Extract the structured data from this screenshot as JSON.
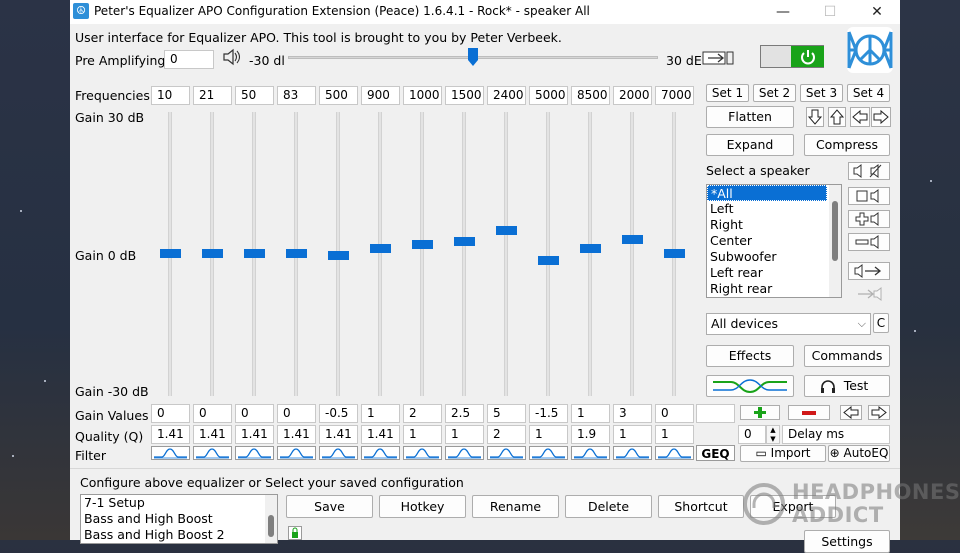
{
  "window": {
    "title": "Peter's Equalizer APO Configuration Extension (Peace) 1.6.4.1 - Rock* - speaker All",
    "minimize": "—",
    "maximize": "☐",
    "close": "✕"
  },
  "header": {
    "intro": "User interface for Equalizer APO. This tool is brought to you by Peter Verbeek.",
    "pre_amp_label": "Pre Amplifying",
    "pre_amp_value": "0",
    "pre_amp_min": "-30 dl",
    "pre_amp_max": "30 dE",
    "pre_amp_fraction": 0.5,
    "power_color": "#19a319"
  },
  "eq": {
    "frequencies_label": "Frequencies",
    "gain_top_label": "Gain 30 dB",
    "gain_mid_label": "Gain 0 dB",
    "gain_bottom_label": "Gain -30 dB",
    "gain_values_label": "Gain Values",
    "quality_label": "Quality (Q)",
    "filter_label": "Filter",
    "gain_range": [
      -30,
      30
    ],
    "bands": [
      {
        "freq": "10",
        "gain": "0",
        "q": "1.41"
      },
      {
        "freq": "21",
        "gain": "0",
        "q": "1.41"
      },
      {
        "freq": "50",
        "gain": "0",
        "q": "1.41"
      },
      {
        "freq": "83",
        "gain": "0",
        "q": "1.41"
      },
      {
        "freq": "500",
        "gain": "-0.5",
        "q": "1.41"
      },
      {
        "freq": "900",
        "gain": "1",
        "q": "1.41"
      },
      {
        "freq": "1000",
        "gain": "2",
        "q": "1"
      },
      {
        "freq": "1500",
        "gain": "2.5",
        "q": "1"
      },
      {
        "freq": "2400",
        "gain": "5",
        "q": "2"
      },
      {
        "freq": "5000",
        "gain": "-1.5",
        "q": "1"
      },
      {
        "freq": "8500",
        "gain": "1",
        "q": "1.9"
      },
      {
        "freq": "2000",
        "gain": "3",
        "q": "1"
      },
      {
        "freq": "7000",
        "gain": "0",
        "q": "1"
      }
    ],
    "geq_label": "GEQ",
    "delay_value": "0",
    "delay_label": "Delay ms",
    "import_label": "Import",
    "autoeq_label": "AutoEQ"
  },
  "right_panel": {
    "sets": [
      "Set 1",
      "Set 2",
      "Set 3",
      "Set 4"
    ],
    "flatten": "Flatten",
    "expand": "Expand",
    "compress": "Compress",
    "select_speaker": "Select a speaker",
    "speakers": [
      "*All",
      "Left",
      "Right",
      "Center",
      "Subwoofer",
      "Left rear",
      "Right rear"
    ],
    "device": "All devices",
    "device_c": "C",
    "effects": "Effects",
    "commands": "Commands",
    "test": "Test"
  },
  "bottom": {
    "configure_label": "Configure above equalizer or Select your saved configuration",
    "configs": [
      "7-1 Setup",
      "Bass and High Boost",
      "Bass and High Boost 2"
    ],
    "save": "Save",
    "hotkey": "Hotkey",
    "rename": "Rename",
    "delete": "Delete",
    "shortcut": "Shortcut",
    "export": "Export",
    "settings": "Settings"
  },
  "watermark": {
    "line1": "HEADPHONES",
    "line2": "ADDICT"
  },
  "colors": {
    "accent": "#0a6fd4",
    "logo": "#2e8fd8"
  }
}
